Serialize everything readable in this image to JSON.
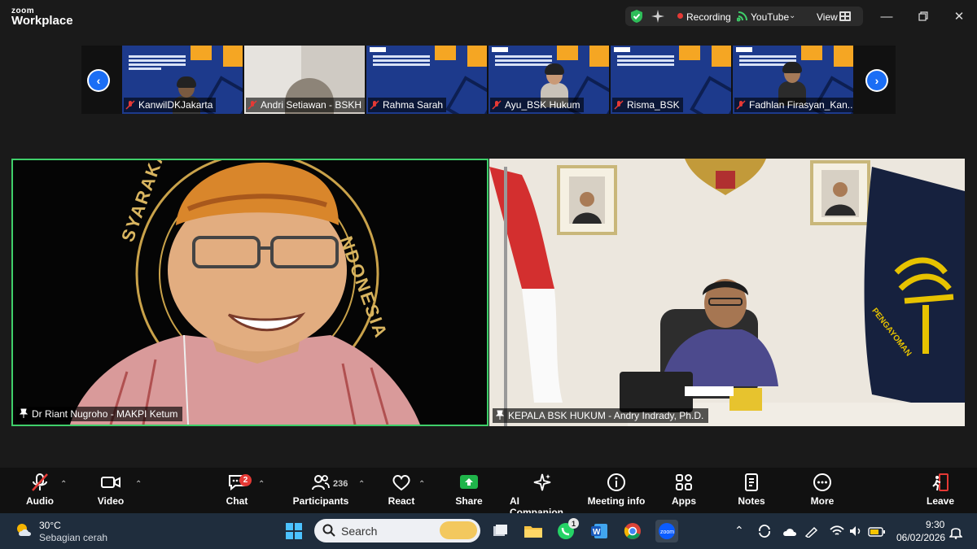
{
  "app": {
    "brand_top": "zoom",
    "brand_bottom": "Workplace"
  },
  "status": {
    "recording": "Recording",
    "stream": "YouTube",
    "view": "View"
  },
  "thumbnails": [
    {
      "name": "KanwilDKJakarta"
    },
    {
      "name": "Andri Setiawan - BSKH"
    },
    {
      "name": "Rahma Sarah"
    },
    {
      "name": "Ayu_BSK Hukum"
    },
    {
      "name": "Risma_BSK"
    },
    {
      "name": "Fadhlan Firasyan_Kan..."
    }
  ],
  "videos": {
    "left": {
      "name": "Dr Riant Nugroho - MAKPI Ketum",
      "seal_text_left": "SYARAKAT KEB",
      "seal_text_right": "NDONESIA"
    },
    "right": {
      "name": "KEPALA BSK HUKUM - Andry Indrady, Ph.D.",
      "flag_text": "PENGAYOMAN"
    }
  },
  "toolbar": {
    "audio": "Audio",
    "video": "Video",
    "chat": "Chat",
    "chat_badge": "2",
    "participants": "Participants",
    "participants_count": "236",
    "react": "React",
    "share": "Share",
    "ai": "AI Companion",
    "info": "Meeting info",
    "apps": "Apps",
    "notes": "Notes",
    "more": "More",
    "leave": "Leave"
  },
  "taskbar": {
    "weather_temp": "30°C",
    "weather_desc": "Sebagian cerah",
    "search_placeholder": "Search",
    "whatsapp_badge": "1",
    "time": "9:30",
    "date": "06/02/2026"
  },
  "colors": {
    "accent_green": "#3fcf6a",
    "zoom_blue": "#1b6ef5",
    "record_red": "#e53935",
    "leave_red": "#e53935",
    "share_green": "#1fb44a"
  }
}
